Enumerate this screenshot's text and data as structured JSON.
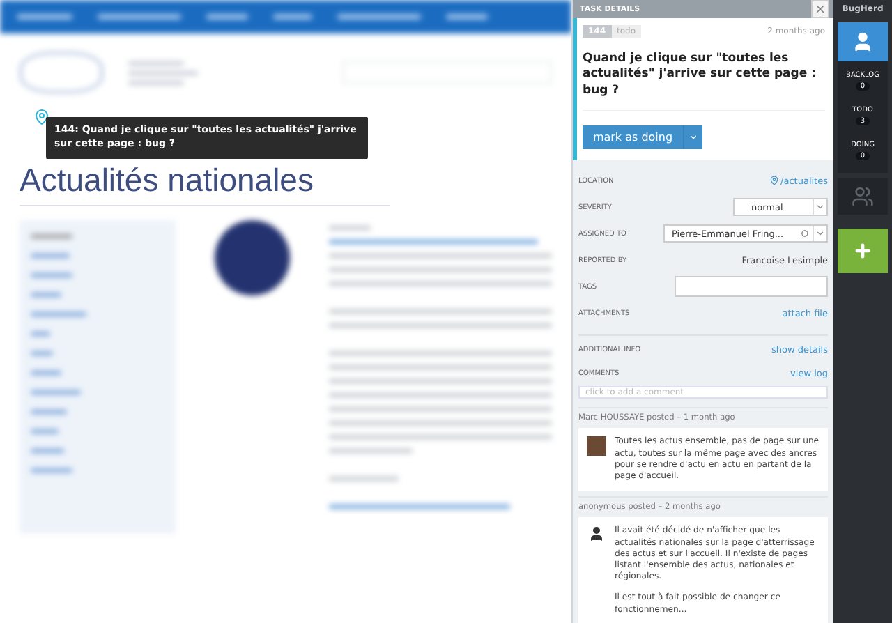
{
  "website": {
    "heading": "Actualités nationales"
  },
  "tooltip": {
    "text": "144: Quand je clique sur \"toutes les actualités\" j'arrive sur cette page : bug ?"
  },
  "panel": {
    "title": "TASK DETAILS"
  },
  "task": {
    "id": "144",
    "status": "todo",
    "time": "2 months ago",
    "title": "Quand je clique sur \"toutes les actualités\" j'arrive sur cette page : bug ?",
    "action": "mark as doing"
  },
  "fields": [
    {
      "kind": "location",
      "label": "LOCATION",
      "value": "/actualites"
    },
    {
      "kind": "select",
      "label": "SEVERITY",
      "value": "normal"
    },
    {
      "kind": "assignee",
      "label": "ASSIGNED TO",
      "value": "Pierre-Emmanuel Fring..."
    },
    {
      "kind": "text",
      "label": "REPORTED BY",
      "value": "Francoise Lesimple"
    },
    {
      "kind": "input",
      "label": "TAGS"
    },
    {
      "kind": "link",
      "label": "ATTACHMENTS",
      "value": "attach file"
    },
    {
      "kind": "link",
      "label": "ADDITIONAL INFO",
      "value": "show details",
      "divided": true
    },
    {
      "kind": "link",
      "label": "COMMENTS",
      "value": "view log"
    }
  ],
  "comment_box": {
    "placeholder": "click to add a comment"
  },
  "comments": [
    {
      "author": "Marc HOUSSAYE posted – 1 month ago",
      "kind": "member",
      "paragraphs": [
        "Toutes les actus ensemble, pas de page sur une actu, toutes sur la même page avec des ancres pour se rendre d'actu en actu en partant de la page d'accueil."
      ]
    },
    {
      "author": "anonymous posted – 2 months ago",
      "kind": "anonymous",
      "paragraphs": [
        "Il avait été décidé de n'afficher que les actualités nationales sur la page d'atterrissage des actus et sur l'accueil. Il n'existe de pages listant l'ensemble des actus, nationales et régionales.",
        "Il est tout à fait possible de changer ce fonctionnemen..."
      ]
    }
  ],
  "sidebar": {
    "brand": "BugHerd",
    "views": [
      {
        "kind": "mine",
        "selected": true,
        "counts": [
          {
            "label": "BACKLOG",
            "count": "0"
          },
          {
            "label": "TODO",
            "count": "3"
          },
          {
            "label": "DOING",
            "count": "0"
          }
        ]
      },
      {
        "kind": "team",
        "selected": false
      }
    ]
  }
}
